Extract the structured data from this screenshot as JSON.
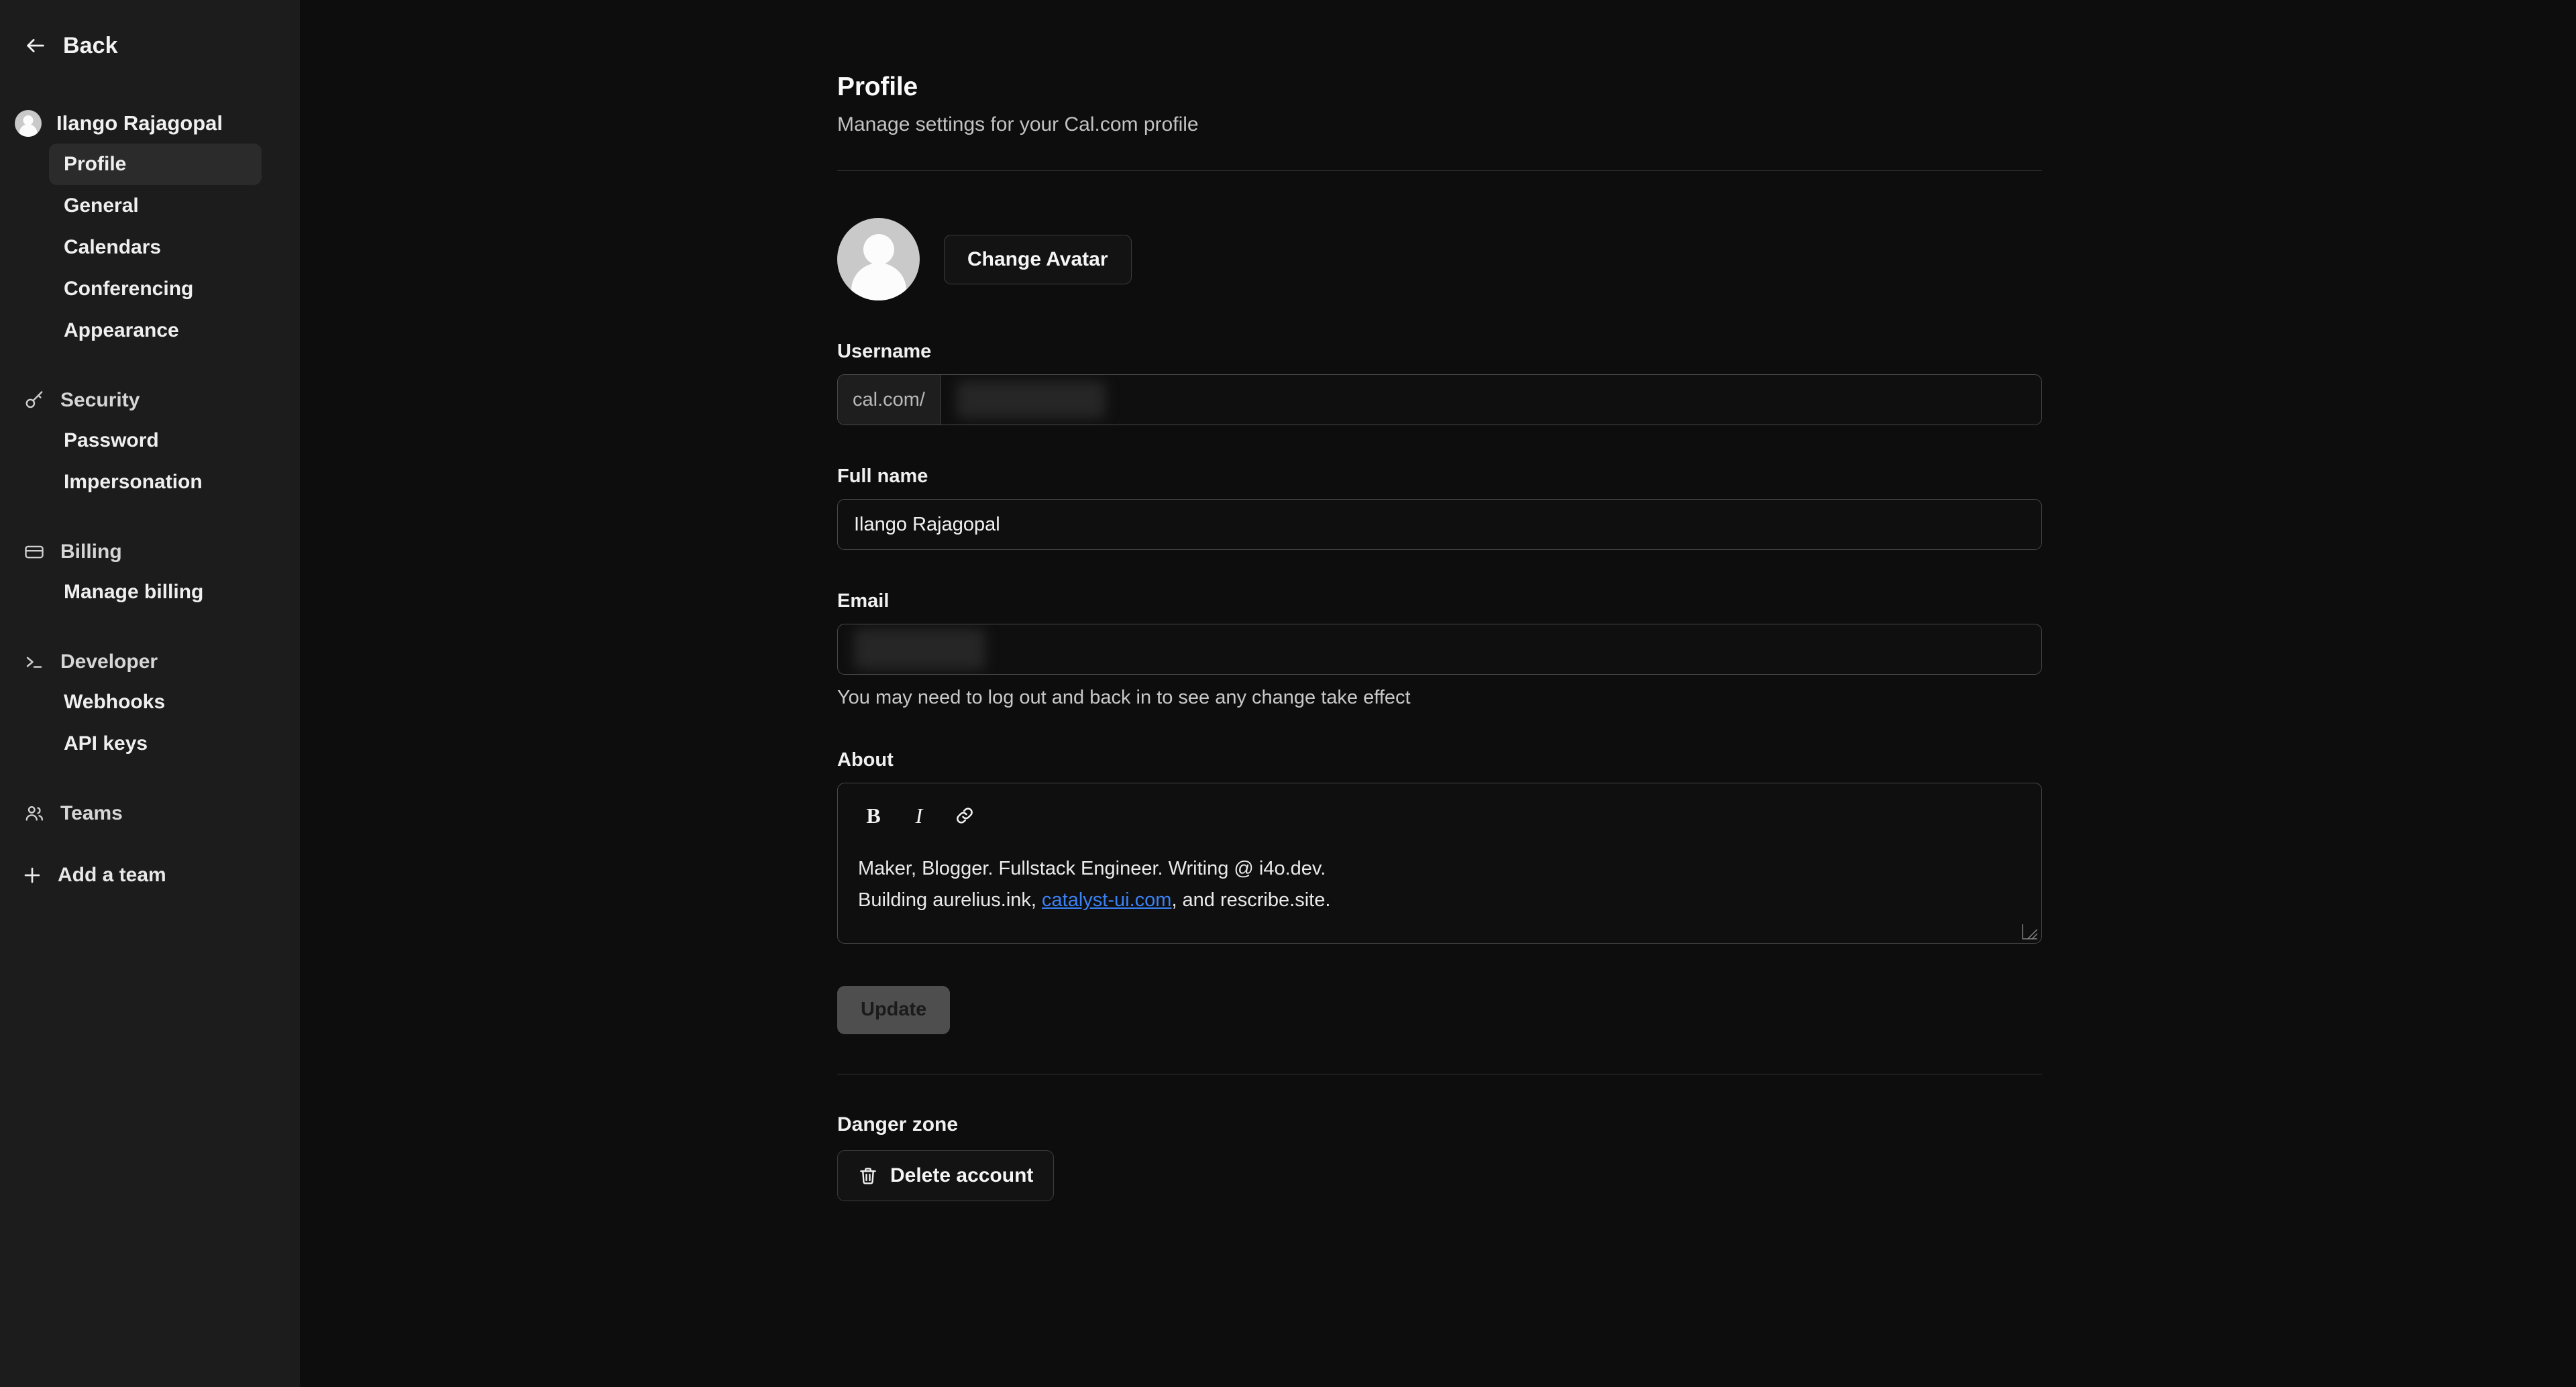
{
  "sidebar": {
    "back_label": "Back",
    "user_name": "Ilango Rajagopal",
    "avatar_icon": "user-avatar-icon",
    "back_icon": "arrow-left-icon",
    "primary_items": [
      {
        "label": "Profile",
        "active": true
      },
      {
        "label": "General",
        "active": false
      },
      {
        "label": "Calendars",
        "active": false
      },
      {
        "label": "Conferencing",
        "active": false
      },
      {
        "label": "Appearance",
        "active": false
      }
    ],
    "sections": [
      {
        "label": "Security",
        "icon": "key-icon",
        "items": [
          {
            "label": "Password"
          },
          {
            "label": "Impersonation"
          }
        ]
      },
      {
        "label": "Billing",
        "icon": "credit-card-icon",
        "items": [
          {
            "label": "Manage billing"
          }
        ]
      },
      {
        "label": "Developer",
        "icon": "terminal-icon",
        "items": [
          {
            "label": "Webhooks"
          },
          {
            "label": "API keys"
          }
        ]
      },
      {
        "label": "Teams",
        "icon": "users-icon",
        "items": []
      }
    ],
    "add_team": {
      "label": "Add a team",
      "icon": "plus-icon"
    }
  },
  "main": {
    "title": "Profile",
    "subtitle": "Manage settings for your Cal.com profile",
    "avatar": {
      "icon": "user-avatar-icon",
      "change_label": "Change Avatar"
    },
    "username": {
      "label": "Username",
      "prefix": "cal.com/",
      "value": "",
      "redacted": true
    },
    "fullname": {
      "label": "Full name",
      "value": "Ilango Rajagopal"
    },
    "email": {
      "label": "Email",
      "value": "",
      "redacted": true,
      "hint": "You may need to log out and back in to see any change take effect"
    },
    "about": {
      "label": "About",
      "toolbar": [
        {
          "name": "bold",
          "glyph": "B"
        },
        {
          "name": "italic",
          "glyph": "I"
        },
        {
          "name": "link",
          "glyph": "link-icon"
        }
      ],
      "line1": "Maker, Blogger. Fullstack Engineer. Writing @ i4o.dev.",
      "line2_before": "Building aurelius.ink, ",
      "line2_link": "catalyst-ui.com",
      "line2_after": ", and rescribe.site."
    },
    "update_label": "Update",
    "danger": {
      "title": "Danger zone",
      "delete_label": "Delete account",
      "delete_icon": "trash-icon"
    }
  },
  "colors": {
    "sidebar_bg": "#1c1c1c",
    "main_bg": "#0d0d0d",
    "active_item_bg": "#2b2b2b",
    "border": "#4a4a4a",
    "link": "#3b82f6",
    "disabled_button_bg": "#4e4e4e"
  }
}
